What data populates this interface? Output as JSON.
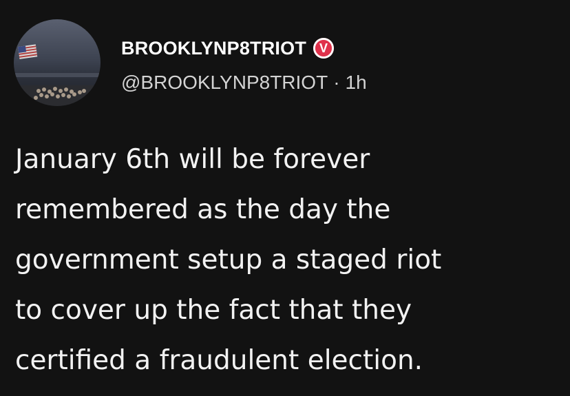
{
  "post": {
    "display_name": "BROOKLYNP8TRIOT",
    "verified_badge_letter": "V",
    "handle": "@BROOKLYNP8TRIOT",
    "separator": "·",
    "time_ago": "1h",
    "text_lines": [
      "January 6th will be forever",
      "remembered as the day the",
      "government setup a staged riot",
      "to cover up the fact that they",
      "certified a fraudulent election."
    ]
  },
  "colors": {
    "background": "#121212",
    "badge": "#e0314b",
    "text": "#f2f2f2",
    "meta_text": "#d4d4d4"
  },
  "icons": {
    "verified": "verified-badge-icon",
    "avatar": "profile-avatar"
  }
}
